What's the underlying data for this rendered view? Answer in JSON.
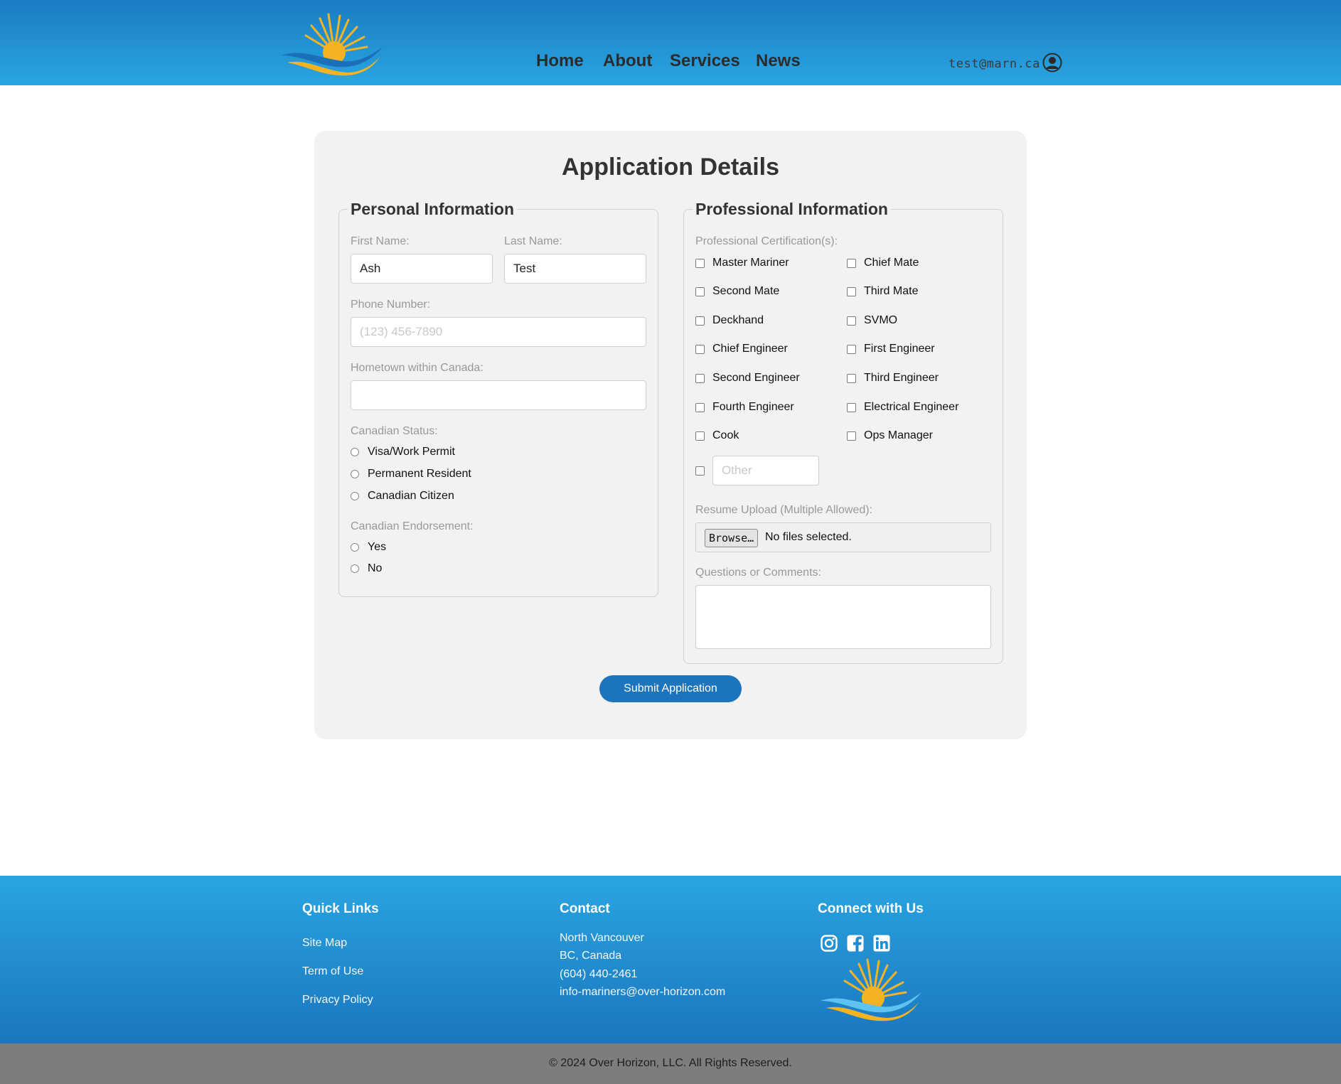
{
  "header": {
    "nav": [
      "Home",
      "About",
      "Services",
      "News"
    ],
    "user_email": "test@marn.ca"
  },
  "form": {
    "title": "Application Details",
    "personal": {
      "legend": "Personal Information",
      "first_name_label": "First Name:",
      "first_name_value": "Ash",
      "last_name_label": "Last Name:",
      "last_name_value": "Test",
      "phone_label": "Phone Number:",
      "phone_placeholder": "(123) 456-7890",
      "hometown_label": "Hometown within Canada:",
      "status_label": "Canadian Status:",
      "status_options": [
        "Visa/Work Permit",
        "Permanent Resident",
        "Canadian Citizen"
      ],
      "endorsement_label": "Canadian Endorsement:",
      "endorsement_options": [
        "Yes",
        "No"
      ]
    },
    "professional": {
      "legend": "Professional Information",
      "cert_label": "Professional Certification(s):",
      "certifications": [
        "Master Mariner",
        "Chief Mate",
        "Second Mate",
        "Third Mate",
        "Deckhand",
        "SVMO",
        "Chief Engineer",
        "First Engineer",
        "Second Engineer",
        "Third Engineer",
        "Fourth Engineer",
        "Electrical Engineer",
        "Cook",
        "Ops Manager"
      ],
      "other_placeholder": "Other",
      "resume_label": "Resume Upload (Multiple Allowed):",
      "browse_label": "Browse…",
      "file_status": "No files selected.",
      "comments_label": "Questions or Comments:"
    },
    "submit_label": "Submit Application"
  },
  "footer": {
    "quick_links_heading": "Quick Links",
    "quick_links": [
      "Site Map",
      "Term of Use",
      "Privacy Policy"
    ],
    "contact_heading": "Contact",
    "contact_lines": [
      "North Vancouver",
      "BC, Canada",
      "(604) 440-2461",
      "info-mariners@over-horizon.com"
    ],
    "connect_heading": "Connect with Us",
    "social_icons": [
      "instagram-icon",
      "facebook-icon",
      "linkedin-icon"
    ],
    "copyright": "© 2024 Over Horizon, LLC. All Rights Reserved."
  },
  "colors": {
    "header_top": "#1a7cc4",
    "header_bottom": "#2aa5e0",
    "submit_button": "#1c74bd",
    "card_bg": "#f2f2f2",
    "copyright_bar": "#7d7d7d",
    "logo_sun": "#f5b324",
    "logo_wave": "#1a6fb8"
  }
}
